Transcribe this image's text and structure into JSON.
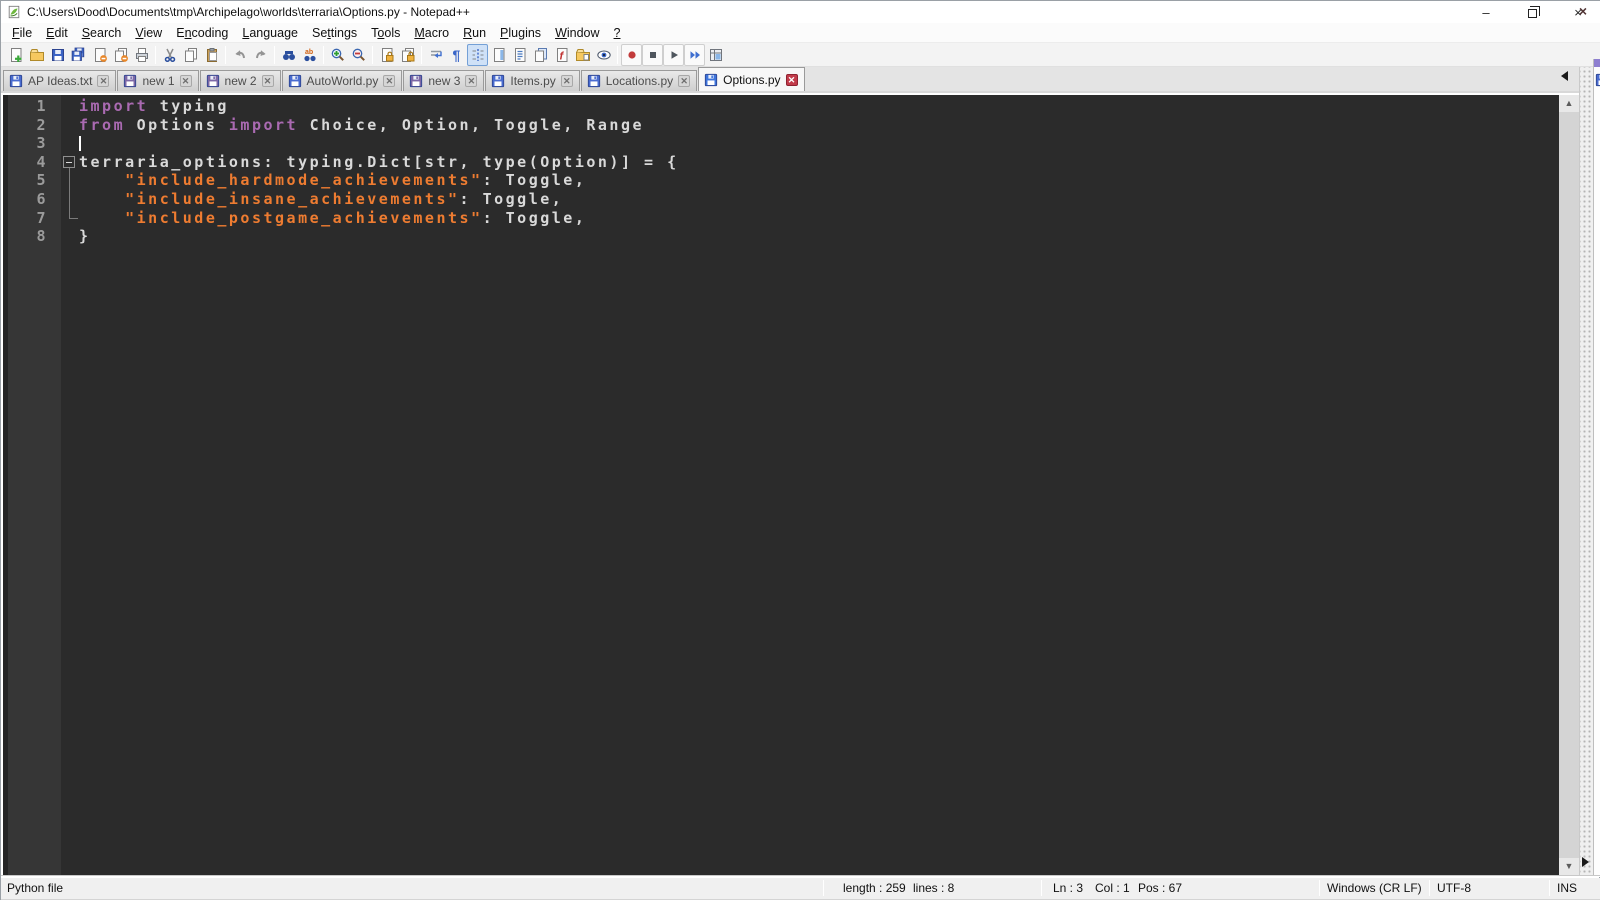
{
  "window": {
    "title": "C:\\Users\\Dood\\Documents\\tmp\\Archipelago\\worlds\\terraria\\Options.py - Notepad++",
    "controls": {
      "minimize": "minimize",
      "restore": "restore",
      "close": "close"
    }
  },
  "menu": {
    "items": [
      {
        "label": "File",
        "underline": 0
      },
      {
        "label": "Edit",
        "underline": 0
      },
      {
        "label": "Search",
        "underline": 0
      },
      {
        "label": "View",
        "underline": 0
      },
      {
        "label": "Encoding",
        "underline": 1
      },
      {
        "label": "Language",
        "underline": 0
      },
      {
        "label": "Settings",
        "underline": 2
      },
      {
        "label": "Tools",
        "underline": 1
      },
      {
        "label": "Macro",
        "underline": 0
      },
      {
        "label": "Run",
        "underline": 0
      },
      {
        "label": "Plugins",
        "underline": 0
      },
      {
        "label": "Window",
        "underline": 0
      },
      {
        "label": "?",
        "underline": 0
      }
    ],
    "close_glyph": "x"
  },
  "toolbar": {
    "icons": [
      "new-file",
      "open-folder",
      "save",
      "save-all",
      "close",
      "close-all",
      "print",
      "|",
      "cut",
      "copy",
      "paste",
      "|",
      "undo",
      "redo",
      "|",
      "find",
      "replace",
      "|",
      "zoom-in",
      "zoom-out",
      "|",
      "sync-vertical",
      "sync-horizontal",
      "|",
      "word-wrap",
      "show-all-characters",
      "indent-guide",
      "document-map",
      "document-list",
      "clone-document",
      "function-list",
      "folder-as-workspace",
      "monitoring",
      "|",
      "macro-record",
      "macro-stop",
      "macro-play",
      "macro-run-multiple",
      "macro-save"
    ],
    "active_icon": "indent-guide",
    "boxed_icons": [
      "macro-record",
      "macro-stop",
      "macro-play",
      "macro-run-multiple"
    ]
  },
  "tabs": [
    {
      "label": "AP Ideas.txt",
      "state": "saved",
      "active": false
    },
    {
      "label": "new 1",
      "state": "modified",
      "active": false
    },
    {
      "label": "new 2",
      "state": "modified",
      "active": false
    },
    {
      "label": "AutoWorld.py",
      "state": "saved",
      "active": false
    },
    {
      "label": "new 3",
      "state": "modified",
      "active": false
    },
    {
      "label": "Items.py",
      "state": "saved",
      "active": false
    },
    {
      "label": "Locations.py",
      "state": "saved",
      "active": false
    },
    {
      "label": "Options.py",
      "state": "saved",
      "active": true
    }
  ],
  "editor": {
    "caret": {
      "line": 3,
      "col": 1
    },
    "lines": [
      {
        "num": "1",
        "tokens": [
          {
            "t": "import",
            "c": "kw"
          },
          {
            "t": " typing",
            "c": "pl"
          }
        ]
      },
      {
        "num": "2",
        "tokens": [
          {
            "t": "from",
            "c": "kw"
          },
          {
            "t": " Options ",
            "c": "pl"
          },
          {
            "t": "import",
            "c": "kw"
          },
          {
            "t": " Choice, Option, Toggle, Range",
            "c": "pl"
          }
        ]
      },
      {
        "num": "3",
        "tokens": []
      },
      {
        "num": "4",
        "tokens": [
          {
            "t": "terraria_options: typing.Dict[str, type(Option)] = {",
            "c": "pl"
          }
        ]
      },
      {
        "num": "5",
        "tokens": [
          {
            "t": "    ",
            "c": "pl"
          },
          {
            "t": "\"include_hardmode_achievements\"",
            "c": "str"
          },
          {
            "t": ": Toggle,",
            "c": "pl"
          }
        ]
      },
      {
        "num": "6",
        "tokens": [
          {
            "t": "    ",
            "c": "pl"
          },
          {
            "t": "\"include_insane_achievements\"",
            "c": "str"
          },
          {
            "t": ": Toggle,",
            "c": "pl"
          }
        ]
      },
      {
        "num": "7",
        "tokens": [
          {
            "t": "    ",
            "c": "pl"
          },
          {
            "t": "\"include_postgame_achievements\"",
            "c": "str"
          },
          {
            "t": ": Toggle,",
            "c": "pl"
          }
        ]
      },
      {
        "num": "8",
        "tokens": [
          {
            "t": "}",
            "c": "pl"
          }
        ]
      }
    ]
  },
  "status": {
    "doc_type": "Python file",
    "length_label": "length : 259",
    "lines_label": "lines : 8",
    "ln": "Ln : 3",
    "col": "Col : 1",
    "pos": "Pos : 67",
    "eol": "Windows (CR LF)",
    "encoding": "UTF-8",
    "mode": "INS"
  },
  "colors": {
    "editor_bg": "#2b2b2b",
    "margin_bg": "#363636",
    "line_number": "#9b9b9b",
    "default_text": "#d9d9d9",
    "keyword": "#aa6ab2",
    "string": "#ee7c31",
    "caret": "#ffffff",
    "floppy_saved": "#4a6cd0",
    "floppy_modified": "#7d68a6",
    "floppy_active": "#3d74dc",
    "tab_close_active": "#c23b4a"
  }
}
